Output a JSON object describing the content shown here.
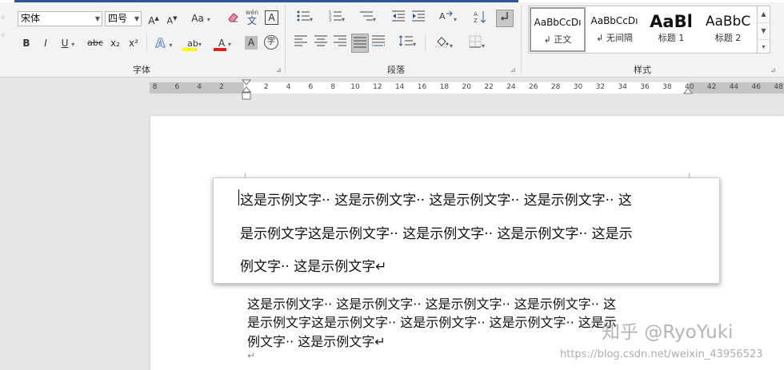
{
  "ribbon": {
    "font_group_label": "字体",
    "paragraph_group_label": "段落",
    "styles_group_label": "样式",
    "font_name": "宋体",
    "font_size": "四号",
    "change_case_label": "Aa",
    "bold": "B",
    "italic": "I",
    "underline": "U",
    "strikethrough": "abc",
    "subscript": "x₂",
    "superscript": "x²",
    "text_effects": "A",
    "font_color": "A",
    "char_shading": "A",
    "enclose_char": "字",
    "phonetic_guide": "wén",
    "phonetic_char": "文",
    "char_border": "A",
    "accent_colors": {
      "font_color_bar": "#e02020",
      "highlight_bar": "#ffff00",
      "brand": "#2b579a"
    }
  },
  "styles": [
    {
      "preview": "AaBbCcDı",
      "name": "↲ 正文"
    },
    {
      "preview": "AaBbCcDı",
      "name": "↲ 无间隔"
    },
    {
      "preview": "AaBl",
      "name": "标题 1"
    },
    {
      "preview": "AaBbC",
      "name": "标题 2"
    }
  ],
  "ruler": {
    "left_ticks": [
      "8",
      "6",
      "4",
      "2"
    ],
    "right_ticks": [
      "2",
      "4",
      "6",
      "8",
      "10",
      "12",
      "14",
      "16",
      "18",
      "20",
      "22",
      "24",
      "26",
      "28",
      "30",
      "32",
      "34",
      "36",
      "38",
      "40",
      "42",
      "44",
      "46",
      "48"
    ]
  },
  "document": {
    "textbox_lines": [
      "这是示例文字·· 这是示例文字·· 这是示例文字·· 这是示例文字·· 这",
      "是示例文字这是示例文字·· 这是示例文字·· 这是示例文字·· 这是示",
      "例文字·· 这是示例文字↵"
    ],
    "body_lines": [
      "这是示例文字·· 这是示例文字·· 这是示例文字·· 这是示例文字·· 这",
      "是示例文字这是示例文字·· 这是示例文字·· 这是示例文字·· 这是示",
      "例文字·· 这是示例文字↵",
      "↵"
    ]
  },
  "watermark": {
    "logo": "知乎 @RyoYuki",
    "url": "https://blog.csdn.net/weixin_43956523"
  }
}
